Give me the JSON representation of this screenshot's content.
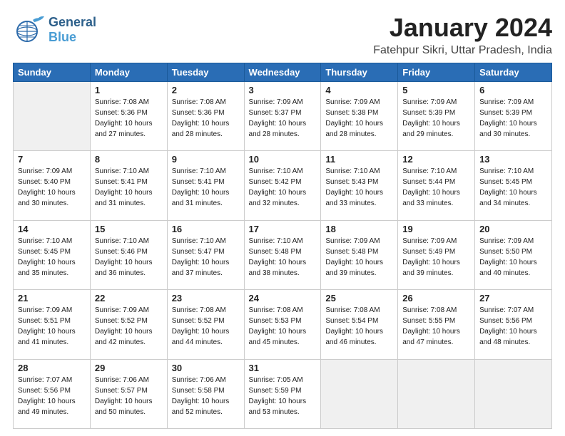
{
  "header": {
    "logo_line1": "General",
    "logo_line2": "Blue",
    "month": "January 2024",
    "location": "Fatehpur Sikri, Uttar Pradesh, India"
  },
  "days_of_week": [
    "Sunday",
    "Monday",
    "Tuesday",
    "Wednesday",
    "Thursday",
    "Friday",
    "Saturday"
  ],
  "weeks": [
    [
      {
        "date": "",
        "info": ""
      },
      {
        "date": "1",
        "info": "Sunrise: 7:08 AM\nSunset: 5:36 PM\nDaylight: 10 hours\nand 27 minutes."
      },
      {
        "date": "2",
        "info": "Sunrise: 7:08 AM\nSunset: 5:36 PM\nDaylight: 10 hours\nand 28 minutes."
      },
      {
        "date": "3",
        "info": "Sunrise: 7:09 AM\nSunset: 5:37 PM\nDaylight: 10 hours\nand 28 minutes."
      },
      {
        "date": "4",
        "info": "Sunrise: 7:09 AM\nSunset: 5:38 PM\nDaylight: 10 hours\nand 28 minutes."
      },
      {
        "date": "5",
        "info": "Sunrise: 7:09 AM\nSunset: 5:39 PM\nDaylight: 10 hours\nand 29 minutes."
      },
      {
        "date": "6",
        "info": "Sunrise: 7:09 AM\nSunset: 5:39 PM\nDaylight: 10 hours\nand 30 minutes."
      }
    ],
    [
      {
        "date": "7",
        "info": "Sunrise: 7:09 AM\nSunset: 5:40 PM\nDaylight: 10 hours\nand 30 minutes."
      },
      {
        "date": "8",
        "info": "Sunrise: 7:10 AM\nSunset: 5:41 PM\nDaylight: 10 hours\nand 31 minutes."
      },
      {
        "date": "9",
        "info": "Sunrise: 7:10 AM\nSunset: 5:41 PM\nDaylight: 10 hours\nand 31 minutes."
      },
      {
        "date": "10",
        "info": "Sunrise: 7:10 AM\nSunset: 5:42 PM\nDaylight: 10 hours\nand 32 minutes."
      },
      {
        "date": "11",
        "info": "Sunrise: 7:10 AM\nSunset: 5:43 PM\nDaylight: 10 hours\nand 33 minutes."
      },
      {
        "date": "12",
        "info": "Sunrise: 7:10 AM\nSunset: 5:44 PM\nDaylight: 10 hours\nand 33 minutes."
      },
      {
        "date": "13",
        "info": "Sunrise: 7:10 AM\nSunset: 5:45 PM\nDaylight: 10 hours\nand 34 minutes."
      }
    ],
    [
      {
        "date": "14",
        "info": "Sunrise: 7:10 AM\nSunset: 5:45 PM\nDaylight: 10 hours\nand 35 minutes."
      },
      {
        "date": "15",
        "info": "Sunrise: 7:10 AM\nSunset: 5:46 PM\nDaylight: 10 hours\nand 36 minutes."
      },
      {
        "date": "16",
        "info": "Sunrise: 7:10 AM\nSunset: 5:47 PM\nDaylight: 10 hours\nand 37 minutes."
      },
      {
        "date": "17",
        "info": "Sunrise: 7:10 AM\nSunset: 5:48 PM\nDaylight: 10 hours\nand 38 minutes."
      },
      {
        "date": "18",
        "info": "Sunrise: 7:09 AM\nSunset: 5:48 PM\nDaylight: 10 hours\nand 39 minutes."
      },
      {
        "date": "19",
        "info": "Sunrise: 7:09 AM\nSunset: 5:49 PM\nDaylight: 10 hours\nand 39 minutes."
      },
      {
        "date": "20",
        "info": "Sunrise: 7:09 AM\nSunset: 5:50 PM\nDaylight: 10 hours\nand 40 minutes."
      }
    ],
    [
      {
        "date": "21",
        "info": "Sunrise: 7:09 AM\nSunset: 5:51 PM\nDaylight: 10 hours\nand 41 minutes."
      },
      {
        "date": "22",
        "info": "Sunrise: 7:09 AM\nSunset: 5:52 PM\nDaylight: 10 hours\nand 42 minutes."
      },
      {
        "date": "23",
        "info": "Sunrise: 7:08 AM\nSunset: 5:52 PM\nDaylight: 10 hours\nand 44 minutes."
      },
      {
        "date": "24",
        "info": "Sunrise: 7:08 AM\nSunset: 5:53 PM\nDaylight: 10 hours\nand 45 minutes."
      },
      {
        "date": "25",
        "info": "Sunrise: 7:08 AM\nSunset: 5:54 PM\nDaylight: 10 hours\nand 46 minutes."
      },
      {
        "date": "26",
        "info": "Sunrise: 7:08 AM\nSunset: 5:55 PM\nDaylight: 10 hours\nand 47 minutes."
      },
      {
        "date": "27",
        "info": "Sunrise: 7:07 AM\nSunset: 5:56 PM\nDaylight: 10 hours\nand 48 minutes."
      }
    ],
    [
      {
        "date": "28",
        "info": "Sunrise: 7:07 AM\nSunset: 5:56 PM\nDaylight: 10 hours\nand 49 minutes."
      },
      {
        "date": "29",
        "info": "Sunrise: 7:06 AM\nSunset: 5:57 PM\nDaylight: 10 hours\nand 50 minutes."
      },
      {
        "date": "30",
        "info": "Sunrise: 7:06 AM\nSunset: 5:58 PM\nDaylight: 10 hours\nand 52 minutes."
      },
      {
        "date": "31",
        "info": "Sunrise: 7:05 AM\nSunset: 5:59 PM\nDaylight: 10 hours\nand 53 minutes."
      },
      {
        "date": "",
        "info": ""
      },
      {
        "date": "",
        "info": ""
      },
      {
        "date": "",
        "info": ""
      }
    ]
  ]
}
